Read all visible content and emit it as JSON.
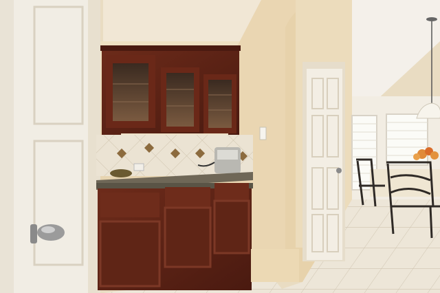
{
  "scene": {
    "kind": "photo-interior",
    "palette": {
      "wall": "#e8d7b6",
      "wall_shadow": "#d9c5a0",
      "ceiling": "#f0e6d4",
      "door": "#f3eee4",
      "door_trim": "#e6dccb",
      "cabinet": "#5a2215",
      "cabinet_light": "#7a3422",
      "counter": "#6f6757",
      "tile_floor": "#ece4d6",
      "backsplash": "#e9e1d1",
      "backsplash_accent": "#8c6b3e",
      "window": "#f7f7f2",
      "chair": "#2f2a26",
      "flowers": "#e08a3a"
    },
    "icons": {
      "door_knob": "door-knob-icon",
      "pendant_light": "pendant-light-icon",
      "toaster": "toaster-icon",
      "light_switch": "light-switch-icon"
    }
  }
}
